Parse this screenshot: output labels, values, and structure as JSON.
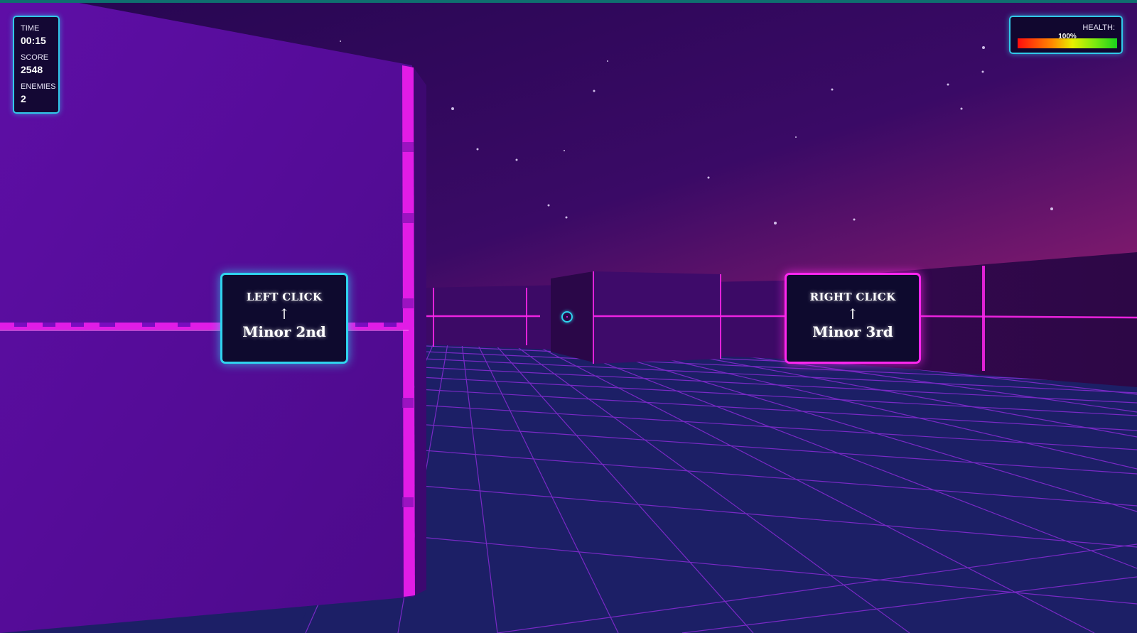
{
  "hud": {
    "time_label": "TIME",
    "time_value": "00:15",
    "score_label": "SCORE",
    "score_value": "2548",
    "enemies_label": "ENEMIES",
    "enemies_value": "2",
    "health_label": "HEALTH:",
    "health_percent_text": "100%",
    "health_fraction": 1.0
  },
  "prompts": {
    "left": {
      "action": "LEFT CLICK",
      "arrow": "↑",
      "interval": "Minor 2nd"
    },
    "right": {
      "action": "RIGHT CLICK",
      "arrow": "↑",
      "interval": "Minor 3rd"
    }
  },
  "colors": {
    "accent_cyan": "#2fd3ee",
    "accent_magenta": "#ff26ee",
    "floor": "#1c1f66",
    "floor_grid": "#8a2bd6",
    "sky_top": "#2a0858",
    "sky_bottom": "#8a1a6e",
    "wall_left": "#5a0d9a"
  }
}
